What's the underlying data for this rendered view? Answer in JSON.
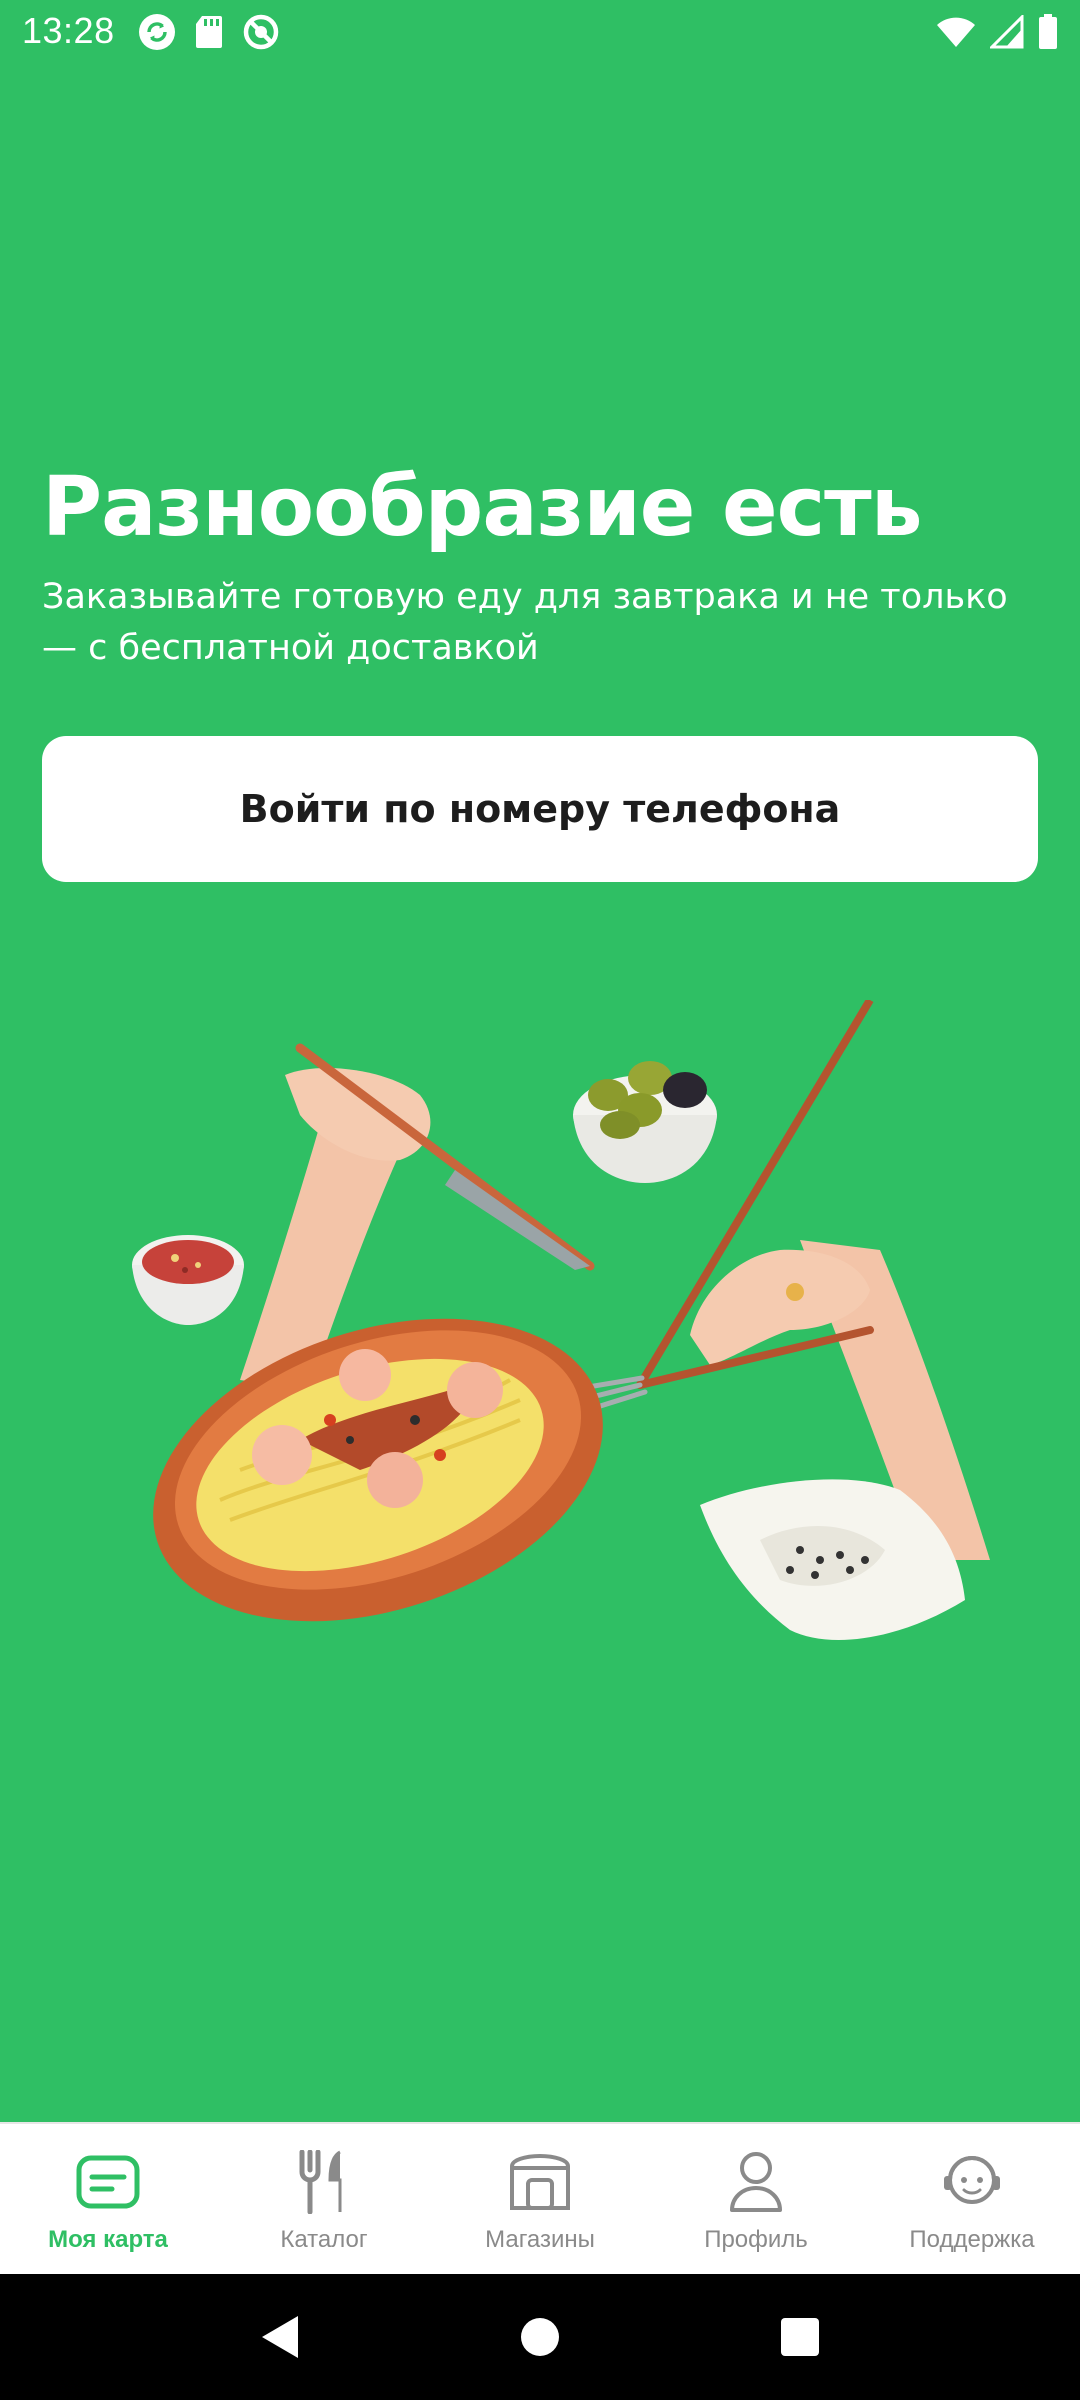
{
  "status_bar": {
    "time": "13:28",
    "icons_left": [
      "sync-icon",
      "sd-card-icon",
      "blocked-icon"
    ],
    "icons_right": [
      "wifi-icon",
      "signal-icon",
      "battery-icon"
    ]
  },
  "hero": {
    "title": "Разнообразие есть",
    "subtitle": "Заказывайте готовую еду для завтрака и не только — с бесплатной доставкой",
    "login_button_label": "Войти по номеру телефона"
  },
  "illustration": {
    "description_icon": "food-illustration-icon"
  },
  "bottom_nav": {
    "items": [
      {
        "label": "Моя карта",
        "icon": "card-icon",
        "active": true
      },
      {
        "label": "Каталог",
        "icon": "cutlery-icon",
        "active": false
      },
      {
        "label": "Магазины",
        "icon": "store-icon",
        "active": false
      },
      {
        "label": "Профиль",
        "icon": "profile-icon",
        "active": false
      },
      {
        "label": "Поддержка",
        "icon": "support-icon",
        "active": false
      }
    ]
  },
  "colors": {
    "brand_green": "#2fbf64",
    "inactive_gray": "#8a8a8a",
    "white": "#ffffff"
  }
}
